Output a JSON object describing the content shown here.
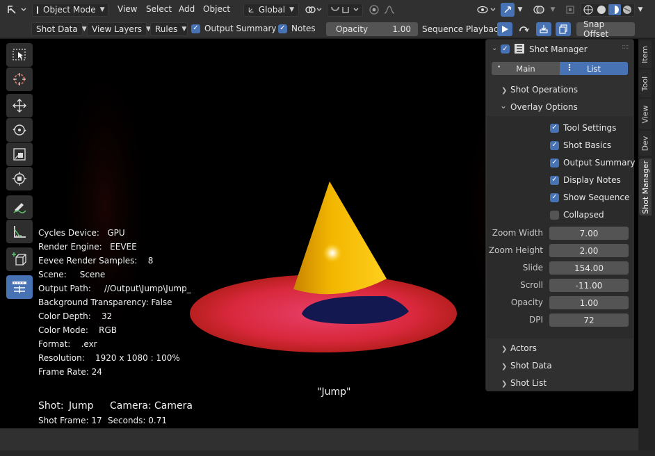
{
  "header": {
    "mode_label": "Object Mode",
    "menus": [
      "View",
      "Select",
      "Add",
      "Object"
    ],
    "transform_orientation": "Global"
  },
  "subheader": {
    "shot_data_label": "Shot Data",
    "view_layers_label": "View Layers",
    "rules_label": "Rules",
    "output_summary_label": "Output Summary",
    "notes_label": "Notes",
    "opacity_label": "Opacity",
    "opacity_value": "1.00",
    "sequence_playback_label": "Sequence Playback:",
    "snap_offset_label": "Snap Offset"
  },
  "overlay": {
    "cycles_device": "Cycles Device:   GPU",
    "render_engine": "Render Engine:   EEVEE",
    "eevee_samples": "Eevee Render Samples:    8",
    "scene": "Scene:     Scene",
    "output_path": "Output Path:     //Output\\Jump\\Jump_",
    "bg_transparency": "Background Transparency: False",
    "color_depth": "Color Depth:    32",
    "color_mode": "Color Mode:    RGB",
    "format": "Format:    .exr",
    "resolution": "Resolution:    1920 x 1080 : 100%",
    "frame_rate": "Frame Rate: 24",
    "shot_name_caption": "\"Jump\"",
    "shot_label": "Shot:",
    "shot_value": "Jump",
    "camera_label": "Camera:",
    "camera_value": "Camera",
    "shot_frame": "Shot Frame: 17",
    "seconds": "Seconds: 0.71"
  },
  "panel": {
    "title": "Shot Manager",
    "tab_main": "Main",
    "tab_list": "List",
    "sections": {
      "shot_operations": "Shot Operations",
      "overlay_options": "Overlay Options",
      "actors": "Actors",
      "shot_data": "Shot Data",
      "shot_list": "Shot List"
    },
    "checkboxes": [
      {
        "label": "Tool Settings",
        "checked": true
      },
      {
        "label": "Shot Basics",
        "checked": true
      },
      {
        "label": "Output Summary",
        "checked": true
      },
      {
        "label": "Display Notes",
        "checked": true
      },
      {
        "label": "Show Sequence",
        "checked": true
      },
      {
        "label": "Collapsed",
        "checked": false
      }
    ],
    "fields": [
      {
        "label": "Zoom Width",
        "value": "7.00"
      },
      {
        "label": "Zoom Height",
        "value": "2.00"
      },
      {
        "label": "Slide",
        "value": "154.00"
      },
      {
        "label": "Scroll",
        "value": "-11.00"
      },
      {
        "label": "Opacity",
        "value": "1.00"
      },
      {
        "label": "DPI",
        "value": "72"
      }
    ]
  },
  "side_tabs": [
    "Item",
    "Tool",
    "View",
    "Dev",
    "Shot Manager"
  ],
  "colors": {
    "accent": "#4772b3",
    "panel_bg": "#303030",
    "field_bg": "#545454",
    "cone": "#f0b400",
    "disc": "#d8283c"
  }
}
